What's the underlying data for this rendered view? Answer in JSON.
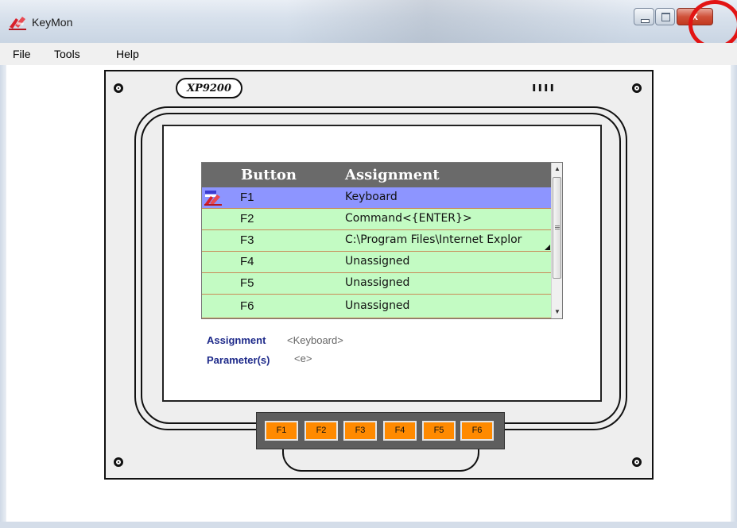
{
  "window": {
    "title": "KeyMon",
    "close_glyph": "x",
    "accent_close": "#c2391f",
    "highlight_color": "#e21414"
  },
  "menu": [
    {
      "label": "File"
    },
    {
      "label": "Tools"
    },
    {
      "label": "Help"
    }
  ],
  "device": {
    "logo": "XP9200",
    "indicators": "ıııı"
  },
  "table": {
    "headers": {
      "button": "Button",
      "assignment": "Assignment"
    },
    "rows": [
      {
        "button": "F1",
        "assignment": "Keyboard",
        "selected": true
      },
      {
        "button": "F2",
        "assignment": "Command<{ENTER}>",
        "selected": false
      },
      {
        "button": "F3",
        "assignment": "C:\\Program Files\\Internet Explor",
        "selected": false
      },
      {
        "button": "F4",
        "assignment": "Unassigned",
        "selected": false
      },
      {
        "button": "F5",
        "assignment": "Unassigned",
        "selected": false
      },
      {
        "button": "F6",
        "assignment": "Unassigned",
        "selected": false
      }
    ],
    "colors": {
      "row": "#c3fbc3",
      "selected_row": "#8d95ff",
      "header": "#6a6a6a"
    }
  },
  "details": {
    "assignment_label": "Assignment",
    "assignment_value": "<Keyboard>",
    "params_label": "Parameter(s)",
    "params_value": "<e>"
  },
  "keypad": {
    "keys": [
      "F1",
      "F2",
      "F3",
      "F4",
      "F5",
      "F6"
    ],
    "key_color": "#ff8a00"
  }
}
